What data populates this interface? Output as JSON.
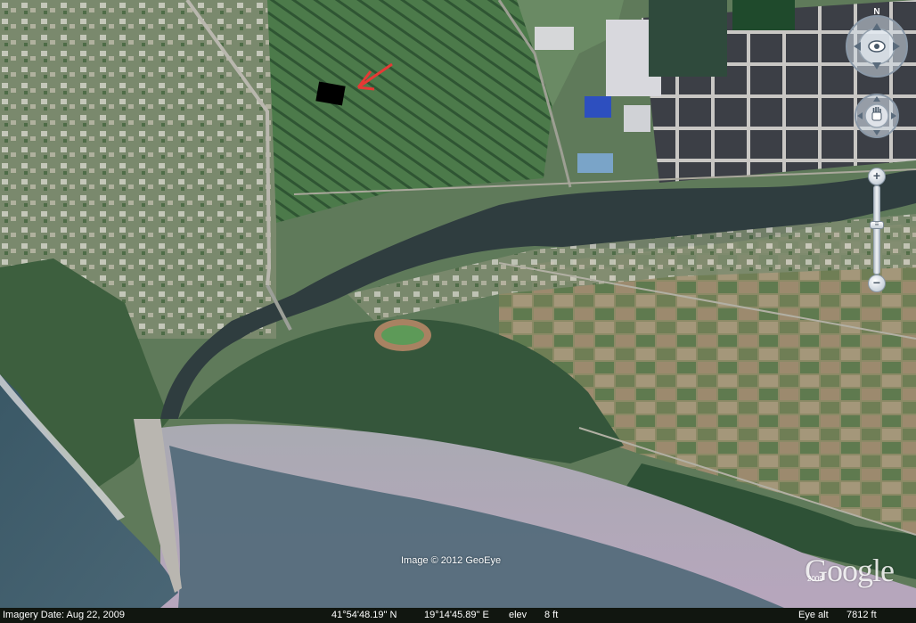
{
  "map": {
    "image_credit": "Image © 2012 GeoEye",
    "logo_text": "Google",
    "logo_year": "2009",
    "marker_color": "#e53935",
    "water_color": "#34505d",
    "field_color": "#4f7a52"
  },
  "controls": {
    "north_label": "N",
    "zoom_in": "+",
    "zoom_out": "−",
    "zoom_level": 0.42
  },
  "status_bar": {
    "imagery_date": "Imagery Date: Aug 22, 2009",
    "latitude": "41°54'48.19\" N",
    "longitude": "19°14'45.89\" E",
    "elev_label": "elev",
    "elev_value": "8 ft",
    "eye_alt_label": "Eye alt",
    "eye_alt_value": "7812 ft"
  }
}
